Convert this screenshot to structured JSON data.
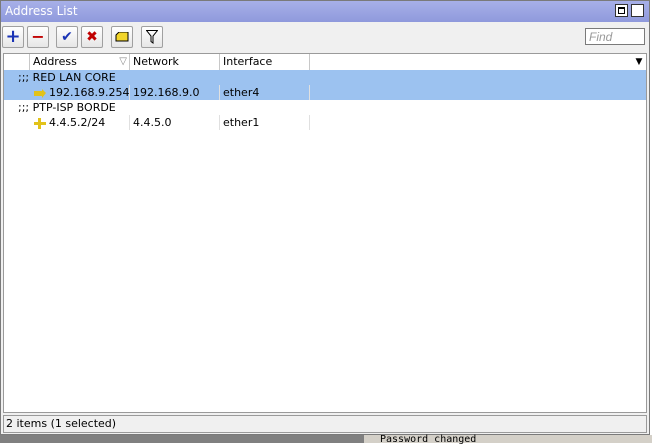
{
  "window": {
    "title": "Address List"
  },
  "toolbar": {
    "add_icon": "plus-icon",
    "remove_icon": "minus-icon",
    "enable_icon": "check-icon",
    "disable_icon": "x-icon",
    "comment_icon": "note-icon",
    "filter_icon": "filter-icon",
    "find_placeholder": "Find"
  },
  "table": {
    "columns": [
      "Address",
      "Network",
      "Interface"
    ],
    "groups": [
      {
        "comment": ";;; RED LAN CORE",
        "rows": [
          {
            "address": "192.168.9.254...",
            "network": "192.168.9.0",
            "interface": "ether4",
            "selected": true
          }
        ]
      },
      {
        "comment": ";;; PTP-ISP BORDE",
        "rows": [
          {
            "address": "4.4.5.2/24",
            "network": "4.4.5.0",
            "interface": "ether1",
            "selected": false
          }
        ]
      }
    ]
  },
  "status": {
    "text": "2 items (1 selected)"
  },
  "background": {
    "text": "Password changed"
  },
  "colors": {
    "titlebar": "#949ee0",
    "selection": "#9cc2f0",
    "address_icon": "#e2c21a"
  }
}
